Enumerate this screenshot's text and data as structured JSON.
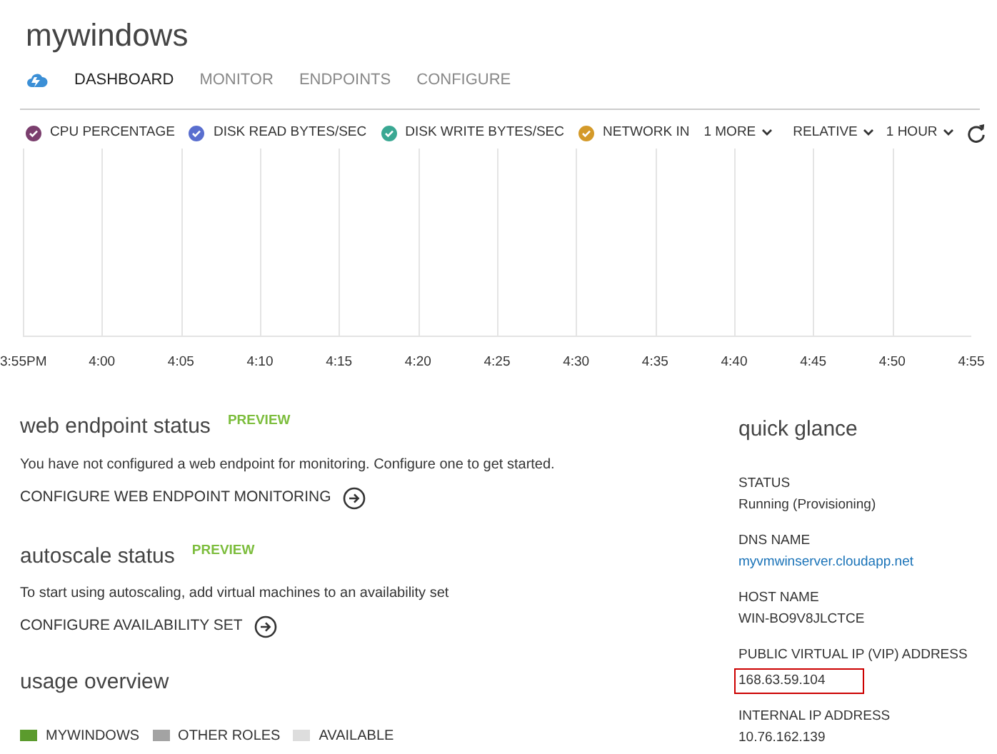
{
  "title": "mywindows",
  "tabs": [
    {
      "label": "DASHBOARD",
      "selected": true
    },
    {
      "label": "MONITOR",
      "selected": false
    },
    {
      "label": "ENDPOINTS",
      "selected": false
    },
    {
      "label": "CONFIGURE",
      "selected": false
    }
  ],
  "metrics": [
    {
      "label": "CPU PERCENTAGE",
      "checked": true,
      "color": "#7b3f6e"
    },
    {
      "label": "DISK READ BYTES/SEC",
      "checked": true,
      "color": "#5a6fcf"
    },
    {
      "label": "DISK WRITE BYTES/SEC",
      "checked": true,
      "color": "#3aa893"
    },
    {
      "label": "NETWORK IN",
      "checked": true,
      "color": "#d49a2a"
    }
  ],
  "dropdowns": [
    "1 MORE",
    "RELATIVE",
    "1 HOUR"
  ],
  "chart": {
    "x_labels": [
      "3:55PM",
      "4:00",
      "4:05",
      "4:10",
      "4:15",
      "4:20",
      "4:25",
      "4:30",
      "4:35",
      "4:40",
      "4:45",
      "4:50",
      "4:55"
    ]
  },
  "sections": [
    {
      "title": "web endpoint status",
      "badge": "PREVIEW",
      "text": "You have not configured a web endpoint for monitoring. Configure one to get started.",
      "link": "CONFIGURE WEB ENDPOINT MONITORING"
    },
    {
      "title": "autoscale status",
      "badge": "PREVIEW",
      "text": "To start using autoscaling, add virtual machines to an availability set",
      "link": "CONFIGURE AVAILABILITY SET"
    }
  ],
  "usage_overview": {
    "title": "usage overview",
    "legend": [
      {
        "label": "MYWINDOWS",
        "color": "#5b9b2d"
      },
      {
        "label": "OTHER ROLES",
        "color": "#a3a3a3"
      },
      {
        "label": "AVAILABLE",
        "color": "#dddddd"
      }
    ]
  },
  "quick_glance": {
    "title": "quick glance",
    "items": [
      {
        "label": "STATUS",
        "value": "Running (Provisioning)",
        "kind": "text",
        "highlighted": false
      },
      {
        "label": "DNS NAME",
        "value": "myvmwinserver.cloudapp.net",
        "kind": "link",
        "highlighted": false
      },
      {
        "label": "HOST NAME",
        "value": "WIN-BO9V8JLCTCE",
        "kind": "text",
        "highlighted": false
      },
      {
        "label": "PUBLIC VIRTUAL IP (VIP) ADDRESS",
        "value": "168.63.59.104",
        "kind": "text",
        "highlighted": true
      },
      {
        "label": "INTERNAL IP ADDRESS",
        "value": "10.76.162.139",
        "kind": "text",
        "highlighted": false
      }
    ]
  }
}
